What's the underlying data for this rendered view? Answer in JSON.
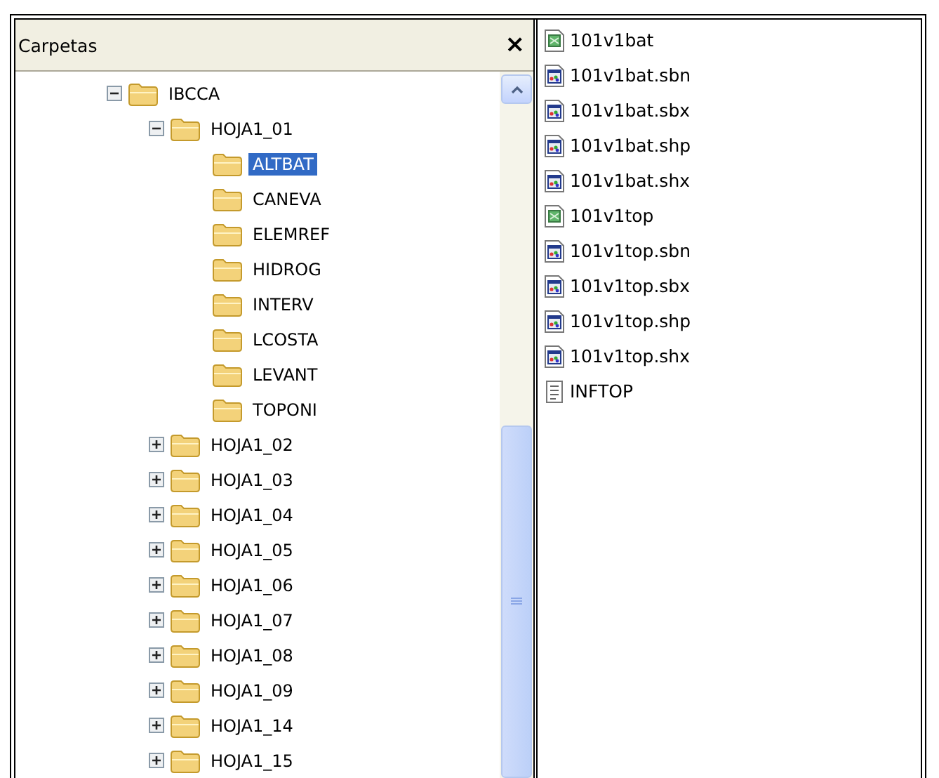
{
  "folders_panel": {
    "title": "Carpetas",
    "close": "×"
  },
  "tree": [
    {
      "label": "IBCCA",
      "expanded": true,
      "selected": false,
      "children": [
        {
          "label": "HOJA1_01",
          "expanded": true,
          "selected": false,
          "children": [
            {
              "label": "ALTBAT",
              "selected": true
            },
            {
              "label": "CANEVA",
              "selected": false
            },
            {
              "label": "ELEMREF",
              "selected": false
            },
            {
              "label": "HIDROG",
              "selected": false
            },
            {
              "label": "INTERV",
              "selected": false
            },
            {
              "label": "LCOSTA",
              "selected": false
            },
            {
              "label": "LEVANT",
              "selected": false
            },
            {
              "label": "TOPONI",
              "selected": false
            }
          ]
        },
        {
          "label": "HOJA1_02",
          "expanded": false,
          "selected": false
        },
        {
          "label": "HOJA1_03",
          "expanded": false,
          "selected": false
        },
        {
          "label": "HOJA1_04",
          "expanded": false,
          "selected": false
        },
        {
          "label": "HOJA1_05",
          "expanded": false,
          "selected": false
        },
        {
          "label": "HOJA1_06",
          "expanded": false,
          "selected": false
        },
        {
          "label": "HOJA1_07",
          "expanded": false,
          "selected": false
        },
        {
          "label": "HOJA1_08",
          "expanded": false,
          "selected": false
        },
        {
          "label": "HOJA1_09",
          "expanded": false,
          "selected": false
        },
        {
          "label": "HOJA1_14",
          "expanded": false,
          "selected": false
        },
        {
          "label": "HOJA1_15",
          "expanded": false,
          "selected": false
        }
      ]
    }
  ],
  "files": [
    {
      "name": "101v1bat",
      "kind": "table"
    },
    {
      "name": "101v1bat.sbn",
      "kind": "shape"
    },
    {
      "name": "101v1bat.sbx",
      "kind": "shape"
    },
    {
      "name": "101v1bat.shp",
      "kind": "shape"
    },
    {
      "name": "101v1bat.shx",
      "kind": "shape"
    },
    {
      "name": "101v1top",
      "kind": "table"
    },
    {
      "name": "101v1top.sbn",
      "kind": "shape"
    },
    {
      "name": "101v1top.sbx",
      "kind": "shape"
    },
    {
      "name": "101v1top.shp",
      "kind": "shape"
    },
    {
      "name": "101v1top.shx",
      "kind": "shape"
    },
    {
      "name": "INFTOP",
      "kind": "text"
    }
  ]
}
